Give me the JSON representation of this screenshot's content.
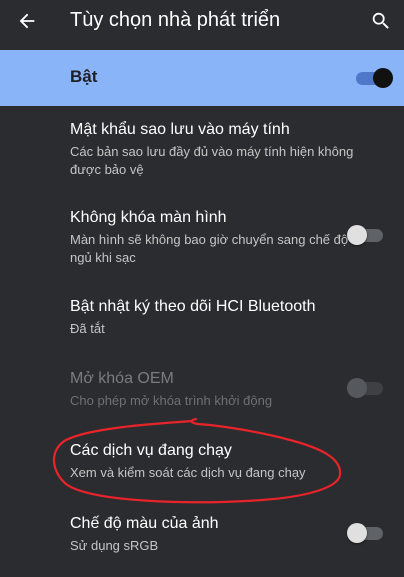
{
  "app_bar": {
    "title": "Tùy chọn nhà phát triển",
    "back_icon": "arrow-back-icon",
    "search_icon": "search-icon"
  },
  "master_switch": {
    "label": "Bật",
    "state": "on"
  },
  "settings": [
    {
      "title": "Mật khẩu sao lưu vào máy tính",
      "summary": "Các bản sao lưu đầy đủ vào máy tính hiện không được bảo vệ"
    },
    {
      "title": "Không khóa màn hình",
      "summary": "Màn hình sẽ không bao giờ chuyển sang chế độ ngủ khi sạc",
      "switch_state": "off"
    },
    {
      "title": "Bật nhật ký theo dõi HCI Bluetooth",
      "summary": "Đã tắt"
    },
    {
      "title": "Mở khóa OEM",
      "summary": "Cho phép mở khóa trình khởi động",
      "switch_state": "off",
      "enabled": false
    },
    {
      "title": "Các dịch vụ đang chạy",
      "summary": "Xem và kiểm soát các dịch vụ đang chạy",
      "highlighted": true
    },
    {
      "title": "Chế độ màu của ảnh",
      "summary": "Sử dụng sRGB",
      "switch_state": "off"
    }
  ],
  "colors": {
    "background": "#2a2c2f",
    "master_bar": "#8ab4f8",
    "annotation": "#e8242a"
  }
}
